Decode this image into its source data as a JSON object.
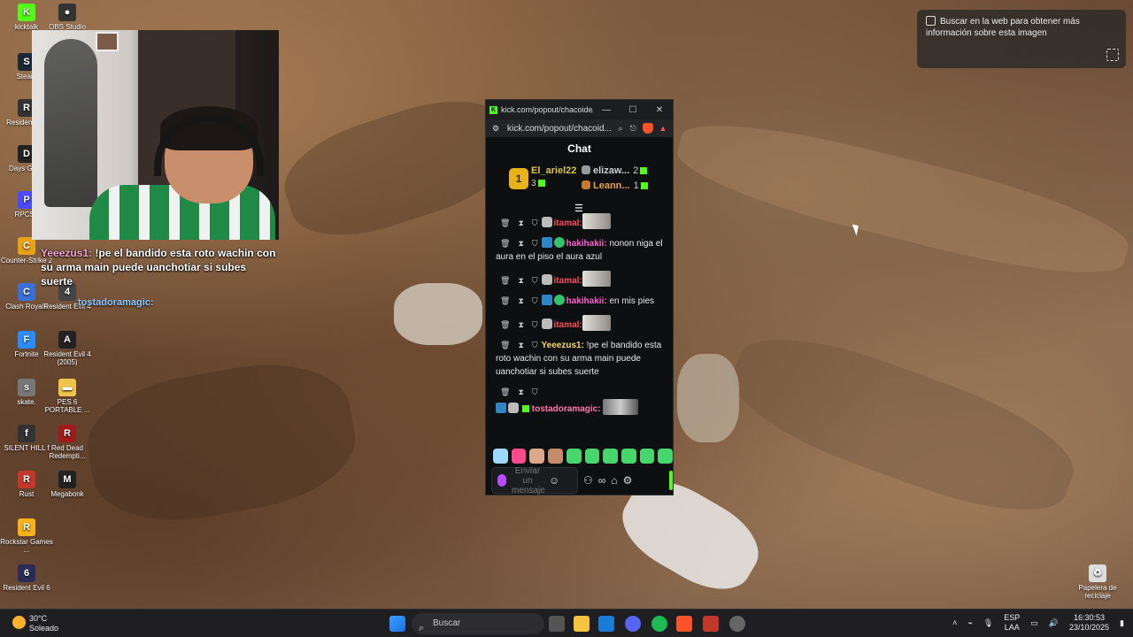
{
  "desktop_icons": [
    {
      "label": "kicktalk",
      "glyph": "K",
      "color": "#53fc18"
    },
    {
      "label": "OBS Studio",
      "glyph": "●",
      "color": "#333333"
    },
    {
      "label": "Steam",
      "glyph": "S",
      "color": "#1b2838"
    },
    {
      "label": "Resident E...",
      "glyph": "R",
      "color": "#333333"
    },
    {
      "label": "Days Gone",
      "glyph": "D",
      "color": "#222222"
    },
    {
      "label": "RPCS3",
      "glyph": "P",
      "color": "#4a4aff"
    },
    {
      "label": "Counter-Strike 2",
      "glyph": "C",
      "color": "#e8a21a"
    },
    {
      "label": "Clash Royale",
      "glyph": "C",
      "color": "#3b6fd8"
    },
    {
      "label": "Resident Evil 4",
      "glyph": "4",
      "color": "#444444"
    },
    {
      "label": "Fortnite",
      "glyph": "F",
      "color": "#2a8cff"
    },
    {
      "label": "Resident Evil 4 (2005)",
      "glyph": "A",
      "color": "#222222"
    },
    {
      "label": "skate.",
      "glyph": "s",
      "color": "#777777"
    },
    {
      "label": "PES 6 PORTABLE ...",
      "glyph": "▬",
      "color": "#f0c44a"
    },
    {
      "label": "SILENT HILL f",
      "glyph": "f",
      "color": "#333333"
    },
    {
      "label": "Red Dead Redempti...",
      "glyph": "R",
      "color": "#a11b1b"
    },
    {
      "label": "Rust",
      "glyph": "R",
      "color": "#c0392b"
    },
    {
      "label": "Megabonk",
      "glyph": "M",
      "color": "#222222"
    },
    {
      "label": "Rockstar Games ...",
      "glyph": "R",
      "color": "#f6b21a"
    },
    {
      "label": "Resident Evil 6",
      "glyph": "6",
      "color": "#2b2b55"
    },
    {
      "label": "Papelera de reciclaje",
      "glyph": "♻",
      "color": "#dddddd"
    }
  ],
  "overlay": {
    "message_user": "Yeeezus1:",
    "message_text": " !pe el bandido esta roto wachin con su arma main puede uanchotiar si subes suerte",
    "user2": "tostadoramagic:"
  },
  "lens": {
    "text": "Buscar en la web para obtener más información sobre esta imagen"
  },
  "browser": {
    "title": "kick.com/popout/chacoide/...",
    "url": "kick.com/popout/chacoid...",
    "brave_badge": "8",
    "chat_title": "Chat",
    "leaderboard": {
      "first": {
        "name": "El_ariel22",
        "count": "3",
        "rank": "1"
      },
      "second": {
        "name": "elizaw...",
        "count": "2"
      },
      "third": {
        "name": "Leann...",
        "count": "1"
      }
    },
    "messages": [
      {
        "user": "itamal:",
        "text": "",
        "user_class": "u-red",
        "badges": "bot",
        "emote": true
      },
      {
        "user": "hakihakii:",
        "text": " nonon niga el aura en el piso el aura azul",
        "user_class": "u-pink",
        "badges": "bv",
        "emote": false
      },
      {
        "user": "itamal:",
        "text": "",
        "user_class": "u-red",
        "badges": "bot",
        "emote": true
      },
      {
        "user": "hakihakii:",
        "text": " en mis pies",
        "user_class": "u-pink",
        "badges": "bv",
        "emote": false
      },
      {
        "user": "itamal:",
        "text": "",
        "user_class": "u-red",
        "badges": "bot",
        "emote": true
      },
      {
        "user": "Yeeezus1:",
        "text": " !pe el bandido esta roto wachin con su arma main puede uanchotiar si subes suerte",
        "user_class": "u-yel",
        "badges": "",
        "emote": false
      }
    ],
    "last_message": {
      "user": "tostadoramagic:",
      "user_class": "u-coral"
    },
    "input_placeholder": "Enviar un mensaje",
    "emote_colors": [
      "#9fd8ff",
      "#ff4b8a",
      "#d9a98a",
      "#c58c6c",
      "#46d66b",
      "#46d66b",
      "#46d66b",
      "#46d66b",
      "#46d66b",
      "#46d66b"
    ]
  },
  "taskbar": {
    "weather_temp": "30°C",
    "weather_desc": "Soleado",
    "search_label": "Buscar",
    "lang1": "ESP",
    "lang2": "LAA",
    "time": "16:30:53",
    "date": "23/10/2025"
  }
}
